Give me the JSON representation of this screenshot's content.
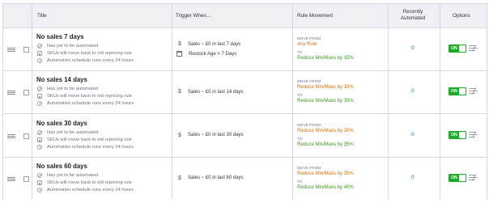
{
  "header": {
    "title": "Title",
    "trigger": "Trigger When...",
    "movement": "Rule Movement",
    "recent": "Recently Automated",
    "options": "Options"
  },
  "labels": {
    "move_from": "MOVE FROM",
    "to": "TO",
    "on": "ON"
  },
  "rows": [
    {
      "title": "No sales 7 days",
      "info": [
        "Has yet to be automated",
        "SKUs will move back to old repricing rule",
        "Automation schedule runs every 24 hours"
      ],
      "triggers": [
        "Sales ~ £0 in last 7 days",
        "Restock Age > 7 Days"
      ],
      "from": "Any Rule",
      "to": "Reduce Min/Maxs by 15%",
      "count": "0"
    },
    {
      "title": "No sales 14 days",
      "info": [
        "Has yet to be automated",
        "SKUs will move back to old repricing rule",
        "Automation schedule runs every 24 hours"
      ],
      "triggers": [
        "Sales ~ £0 in last 14 days"
      ],
      "from": "Reduce Min/Maxs by 15%",
      "to": "Reduce Min/Maxs by 30%",
      "count": "0"
    },
    {
      "title": "No sales 30 days",
      "info": [
        "Has yet to be automated",
        "SKUs will move back to old repricing rule",
        "Automation schedule runs every 24 hours"
      ],
      "triggers": [
        "Sales ~ £0 in last 30 days"
      ],
      "from": "Reduce Min/Maxs by 30%",
      "to": "Reduce Min/Maxs by 35%",
      "count": "0"
    },
    {
      "title": "No sales 60 days",
      "info": [
        "Has yet to be automated",
        "SKUs will move back to old repricing rule",
        "Automation schedule runs every 24 hours"
      ],
      "triggers": [
        "Sales ~ £0 in last 60 days"
      ],
      "from": "Reduce Min/Maxs by 35%",
      "to": "Reduce Min/Maxs by 40%",
      "count": "0"
    }
  ],
  "icons": {
    "drag": "drag-handle-icon",
    "info1": "ban-icon",
    "info2": "document-icon",
    "info3": "clock-icon",
    "sales": "dollar-icon",
    "restock": "calendar-icon",
    "menu": "edit-list-icon"
  },
  "colors": {
    "toggle_on": "#1faa2e",
    "from": "#d4700f",
    "to": "#3c9a21",
    "count": "#2b6cb0",
    "header_bg": "#eef0f3"
  }
}
